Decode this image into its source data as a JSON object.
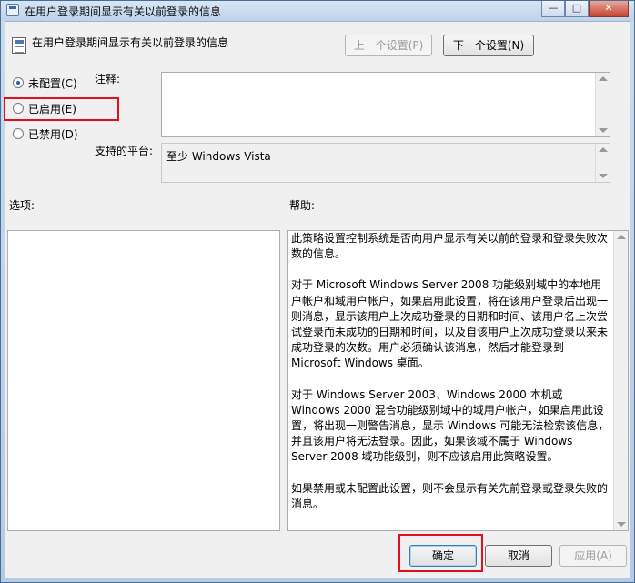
{
  "window": {
    "title": "在用户登录期间显示有关以前登录的信息",
    "controls": {
      "minimize": "—",
      "maximize": "□",
      "close": "✕"
    }
  },
  "policy": {
    "name": "在用户登录期间显示有关以前登录的信息",
    "prev_label": "上一个设置(P)",
    "next_label": "下一个设置(N)"
  },
  "state": {
    "options": [
      {
        "label": "未配置(C)",
        "checked": true
      },
      {
        "label": "已启用(E)",
        "checked": false
      },
      {
        "label": "已禁用(D)",
        "checked": false
      }
    ]
  },
  "comment": {
    "label": "注释:",
    "value": ""
  },
  "platform": {
    "label": "支持的平台:",
    "value": "至少 Windows Vista"
  },
  "options_panel": {
    "label": "选项:"
  },
  "help": {
    "label": "帮助:",
    "paragraphs": [
      "此策略设置控制系统是否向用户显示有关以前的登录和登录失败次数的信息。",
      "对于 Microsoft Windows Server 2008 功能级别域中的本地用户帐户和域用户帐户，如果启用此设置，将在该用户登录后出现一则消息，显示该用户上次成功登录的日期和时间、该用户名上次尝试登录而未成功的日期和时间，以及自该用户上次成功登录以来未成功登录的次数。用户必须确认该消息，然后才能登录到 Microsoft Windows 桌面。",
      "对于 Windows Server 2003、Windows 2000 本机或 Windows 2000 混合功能级别域中的域用户帐户，如果启用此设置，将出现一则警告消息，显示 Windows 可能无法检索该信息，并且该用户将无法登录。因此，如果该域不属于 Windows Server 2008 域功能级别，则不应该启用此策略设置。",
      "如果禁用或未配置此设置，则不会显示有关先前登录或登录失败的消息。"
    ]
  },
  "footer": {
    "ok_label": "确定",
    "cancel_label": "取消",
    "apply_label": "应用(A)"
  },
  "colors": {
    "highlight_box": "#e0101f",
    "radio_checked": "#1d5fb7"
  },
  "icons": [
    "policy-icon",
    "window-icon",
    "scroll-up-icon",
    "scroll-down-icon"
  ]
}
